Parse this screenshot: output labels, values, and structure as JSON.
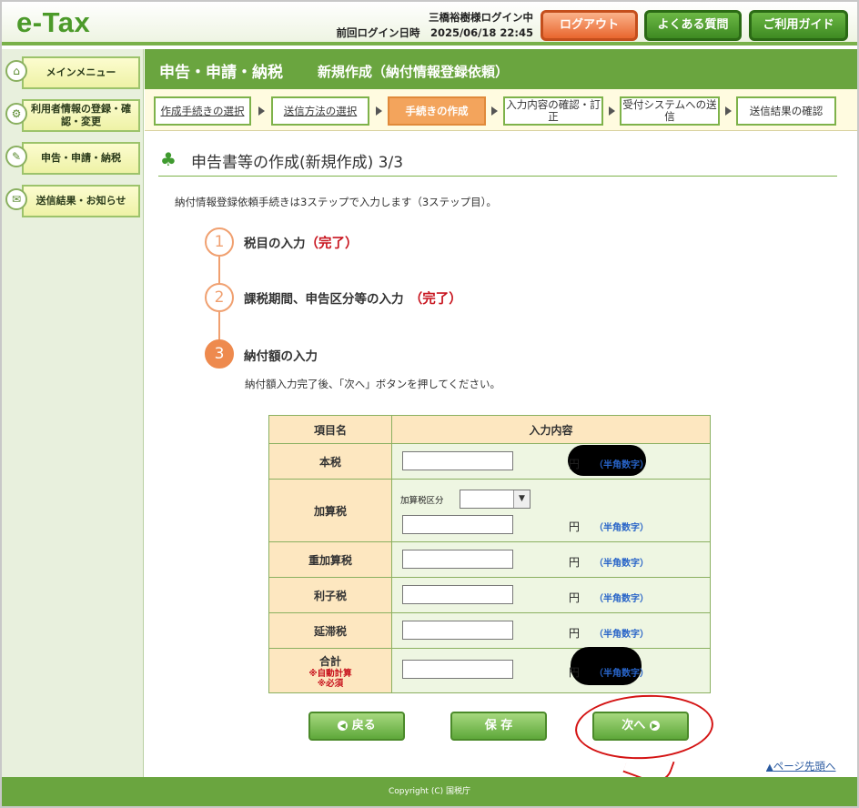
{
  "header": {
    "logo": "e-Tax",
    "user_line": "三橋裕樹様ログイン中",
    "last_login": "前回ログイン日時　2025/06/18 22:45",
    "logout": "ログアウト",
    "faq": "よくある質問",
    "guide": "ご利用ガイド"
  },
  "sidebar": {
    "items": [
      {
        "label": "メインメニュー",
        "icon": "home-icon"
      },
      {
        "label": "利用者情報の登録・確認・変更",
        "icon": "user-settings-icon"
      },
      {
        "label": "申告・申請・納税",
        "icon": "document-icon"
      },
      {
        "label": "送信結果・お知らせ",
        "icon": "mail-icon"
      }
    ]
  },
  "titlebar": {
    "section": "申告・申請・納税",
    "subtitle": "新規作成（納付情報登録依頼）"
  },
  "steps": [
    {
      "label": "作成手続きの選択"
    },
    {
      "label": "送信方法の選択"
    },
    {
      "label": "手続きの作成"
    },
    {
      "label": "入力内容の確認・訂正"
    },
    {
      "label": "受付システムへの送信"
    },
    {
      "label": "送信結果の確認"
    }
  ],
  "page": {
    "heading": "申告書等の作成(新規作成) 3/3",
    "intro": "納付情報登録依頼手続きは3ステップで入力します（3ステップ目）。",
    "step1": {
      "num": "1",
      "label": "税目の入力",
      "status": "（完了）"
    },
    "step2": {
      "num": "2",
      "label": "課税期間、申告区分等の入力",
      "status": "（完了）"
    },
    "step3": {
      "num": "3",
      "label": "納付額の入力"
    },
    "hint": "納付額入力完了後、「次へ」ボタンを押してください。"
  },
  "table": {
    "col_item": "項目名",
    "col_input": "入力内容",
    "unit": "円",
    "note": "（半角数字）",
    "rows": {
      "honzei": "本税",
      "kasanzei": "加算税",
      "kasanzei_kubun": "加算税区分",
      "jukasanzei": "重加算税",
      "rishizei": "利子税",
      "entaizei": "延滞税",
      "total": "合計",
      "auto": "※自動計算",
      "required": "※必須"
    }
  },
  "buttons": {
    "back": "戻る",
    "save": "保 存",
    "next": "次へ"
  },
  "pagetop": "ページ先頭へ",
  "footer": "Copyright (C) 国税庁"
}
